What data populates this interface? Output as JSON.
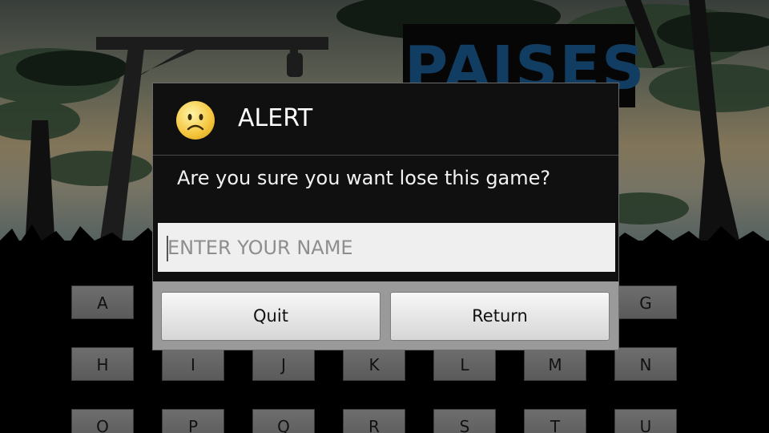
{
  "game": {
    "title": "PAISES",
    "keyboard": {
      "row1": [
        "A",
        "G"
      ],
      "row2": [
        "H",
        "I",
        "J",
        "K",
        "L",
        "M",
        "N"
      ],
      "row3": [
        "O",
        "P",
        "Q",
        "R",
        "S",
        "T",
        "U"
      ]
    }
  },
  "dialog": {
    "icon": "sad-face-icon",
    "title": "ALERT",
    "message": "Are you sure you want lose this game?",
    "input": {
      "placeholder": "ENTER YOUR NAME",
      "value": ""
    },
    "buttons": {
      "quit": "Quit",
      "return": "Return"
    }
  }
}
